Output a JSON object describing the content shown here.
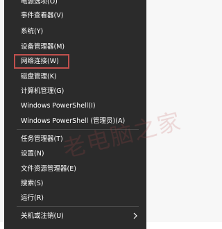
{
  "menu": {
    "items": [
      {
        "label": "电源选项(O)"
      },
      {
        "label": "事件查看器(V)"
      },
      {
        "label": "系统(Y)"
      },
      {
        "label": "设备管理器(M)"
      },
      {
        "label": "网络连接(W)"
      },
      {
        "label": "磁盘管理(K)"
      },
      {
        "label": "计算机管理(G)"
      },
      {
        "label": "Windows PowerShell(I)"
      },
      {
        "label": "Windows PowerShell (管理员)(A)"
      },
      {
        "label": "任务管理器(T)"
      },
      {
        "label": "设置(N)"
      },
      {
        "label": "文件资源管理器(E)"
      },
      {
        "label": "搜索(S)"
      },
      {
        "label": "运行(R)"
      },
      {
        "label": "关机或注销(U)"
      }
    ]
  },
  "watermark": {
    "text": "老电脑之家"
  },
  "colors": {
    "menu_bg": "#2b2b2b",
    "menu_text": "#ffffff",
    "separator": "#4a4a4a",
    "highlight_border": "#c0504d"
  },
  "icons": {
    "submenu": "chevron-right-icon"
  }
}
